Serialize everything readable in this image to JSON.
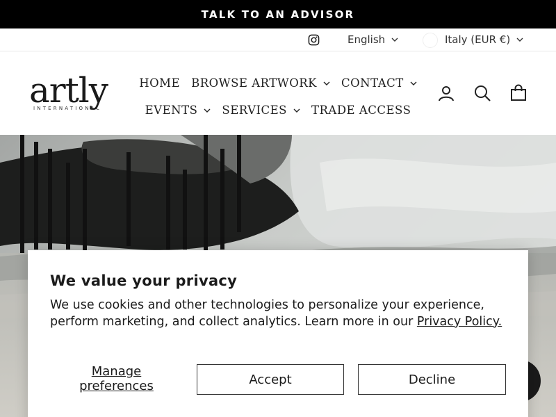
{
  "announcement": {
    "text": "TALK TO AN ADVISOR"
  },
  "utility": {
    "social_icon": "instagram-icon",
    "language": "English",
    "country": "Italy (EUR €)"
  },
  "brand": {
    "name": "artly",
    "tagline": "INTERNATIONAL"
  },
  "nav": {
    "row1": [
      {
        "label": "HOME",
        "dropdown": false
      },
      {
        "label": "BROWSE ARTWORK",
        "dropdown": true
      },
      {
        "label": "CONTACT",
        "dropdown": true
      }
    ],
    "row2": [
      {
        "label": "EVENTS",
        "dropdown": true
      },
      {
        "label": "SERVICES",
        "dropdown": true
      },
      {
        "label": "TRADE ACCESS",
        "dropdown": false
      }
    ]
  },
  "header_icons": [
    "account-icon",
    "search-icon",
    "cart-icon"
  ],
  "cookie": {
    "title": "We value your privacy",
    "body": "We use cookies and other technologies to personalize your experience, perform marketing, and collect analytics. Learn more in our ",
    "link": "Privacy Policy.",
    "manage": "Manage preferences",
    "accept": "Accept",
    "decline": "Decline"
  },
  "colors": {
    "announcement_bg": "#000000",
    "text": "#1c1c1c",
    "border": "#333333"
  }
}
